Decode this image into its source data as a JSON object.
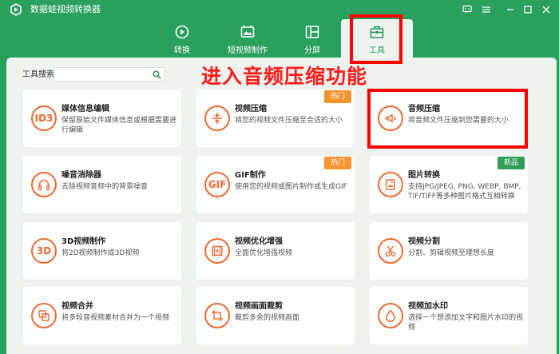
{
  "app": {
    "title": "数据蛙视频转换器"
  },
  "nav": {
    "tabs": [
      {
        "label": "转换"
      },
      {
        "label": "短视频制作"
      },
      {
        "label": "分屏"
      },
      {
        "label": "工具"
      }
    ],
    "active": "工具"
  },
  "search": {
    "label": "工具搜索:",
    "value": "",
    "placeholder": ""
  },
  "annotation": "进入音频压缩功能",
  "tools": [
    {
      "title": "媒体信息编辑",
      "desc": "保留原始文件媒体信息或根据需要进行编辑",
      "icon": "ID3"
    },
    {
      "title": "视频压缩",
      "desc": "将您的视频文件压缩至合适的大小",
      "icon": "compress-icon",
      "badge": "热门"
    },
    {
      "title": "音频压缩",
      "desc": "将音频文件压缩到您需要的大小",
      "icon": "audio-compress-icon"
    },
    {
      "title": "噪音消除器",
      "desc": "去除视频音频中的背景噪音",
      "icon": "headphones-icon"
    },
    {
      "title": "GIF制作",
      "desc": "使用您的视频或图片制作或生成GIF",
      "icon": "GIF",
      "badge": "热门"
    },
    {
      "title": "图片转换",
      "desc": "支持JPG/JPEG, PNG, WEBP, BMP, TIF/TIFF等多种图片格式互相转换",
      "icon": "image-convert-icon",
      "badge": "新品"
    },
    {
      "title": "3D视频制作",
      "desc": "将2D视频制作成3D视频",
      "icon": "3D"
    },
    {
      "title": "视频优化增强",
      "desc": "全面优化增强视频",
      "icon": "film-enhance-icon"
    },
    {
      "title": "视频分割",
      "desc": "分割、剪辑视频至理想长度",
      "icon": "scissors-icon"
    },
    {
      "title": "视频合并",
      "desc": "将多段音视频素材合并为一个视频",
      "icon": "merge-icon"
    },
    {
      "title": "视频画面裁剪",
      "desc": "裁剪多余的视频画面",
      "icon": "crop-icon"
    },
    {
      "title": "视频加水印",
      "desc": "选择一个想添加文字和图片水印的视频",
      "icon": "watermark-drop-icon"
    }
  ],
  "colors": {
    "brand": "#2aa05f",
    "accent": "#ec6a32",
    "hot_badge": "#f59431",
    "new_badge": "#2f9e5b",
    "highlight": "#ff0000"
  }
}
